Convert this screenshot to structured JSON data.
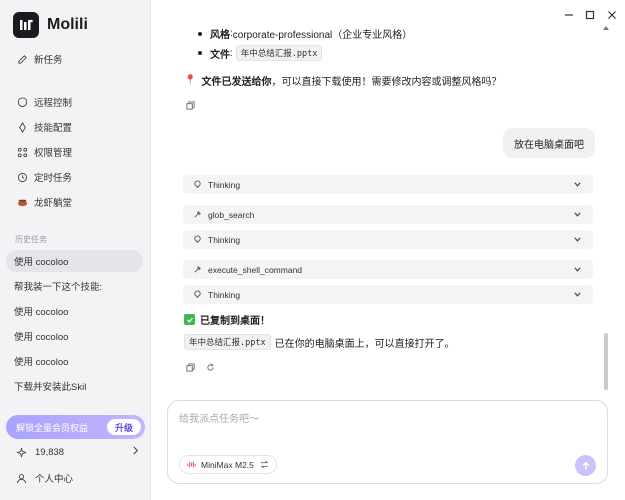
{
  "app": {
    "name": "Molili"
  },
  "sidebar": {
    "new_task": "新任务",
    "nav": [
      {
        "label": "远程控制",
        "icon": "remote-control-icon"
      },
      {
        "label": "技能配置",
        "icon": "skills-icon"
      },
      {
        "label": "权限管理",
        "icon": "permissions-icon"
      },
      {
        "label": "定时任务",
        "icon": "clock-icon"
      },
      {
        "label": "龙虾躺堂",
        "icon": "lobster-icon"
      }
    ],
    "history_label": "历史任务",
    "history": [
      {
        "label": "使用 cocoloo",
        "active": true
      },
      {
        "label": "帮我装一下这个技能:"
      },
      {
        "label": "使用 cocoloo"
      },
      {
        "label": "使用 cocoloo"
      },
      {
        "label": "使用 cocoloo"
      },
      {
        "label": "下载并安装此Skil"
      }
    ],
    "promo": {
      "label": "解锁全量会员权益",
      "button": "升级"
    },
    "credits": "19,838",
    "user_center": "个人中心"
  },
  "chat": {
    "bullets": [
      {
        "key": "风格",
        "sep": ": ",
        "value": "corporate-professional（企业专业风格）"
      },
      {
        "key": "文件",
        "sep": ": ",
        "code": "年中总结汇报.pptx"
      }
    ],
    "assistant_1": {
      "emoji": "📍",
      "bold": "文件已发送给你",
      "rest": "，可以直接下载使用！需要修改内容或调整风格吗？"
    },
    "user_msg": "放在电脑桌面吧",
    "tools": [
      {
        "label": "Thinking",
        "icon": "thinking-icon"
      },
      {
        "label": "glob_search",
        "icon": "tool-icon"
      },
      {
        "label": "Thinking",
        "icon": "thinking-icon"
      },
      {
        "label": "execute_shell_command",
        "icon": "tool-icon"
      },
      {
        "label": "Thinking",
        "icon": "thinking-icon"
      }
    ],
    "status": "已复制到桌面！",
    "result": {
      "code": "年中总结汇报.pptx",
      "text": "已在你的电脑桌面上，可以直接打开了。"
    }
  },
  "input": {
    "placeholder": "给我派点任务吧～",
    "model": "MiniMax M2.5"
  },
  "colors": {
    "accent": "#a9a2ff",
    "send": "#c9c2fb",
    "check": "#3fb950"
  }
}
